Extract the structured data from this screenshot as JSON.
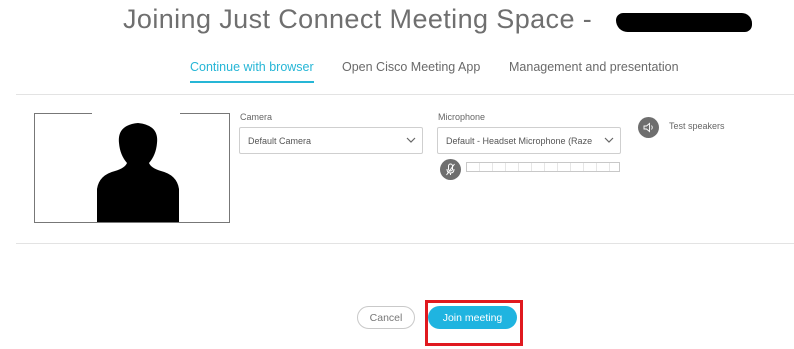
{
  "header": {
    "title": "Joining Just Connect Meeting Space - "
  },
  "tabs": [
    {
      "label": "Continue with browser",
      "active": true
    },
    {
      "label": "Open Cisco Meeting App",
      "active": false
    },
    {
      "label": "Management and presentation",
      "active": false
    }
  ],
  "camera": {
    "label": "Camera",
    "selected": "Default Camera"
  },
  "microphone": {
    "label": "Microphone",
    "selected": "Default - Headset Microphone (Raze"
  },
  "speakers": {
    "label": "Test speakers"
  },
  "actions": {
    "cancel_label": "Cancel",
    "join_label": "Join meeting"
  },
  "colors": {
    "accent": "#26b6d6",
    "join_button": "#1fb4e0",
    "highlight": "#e0191f"
  },
  "icons": [
    "chevron-down-icon",
    "microphone-muted-icon",
    "speaker-icon",
    "person-silhouette-icon"
  ]
}
